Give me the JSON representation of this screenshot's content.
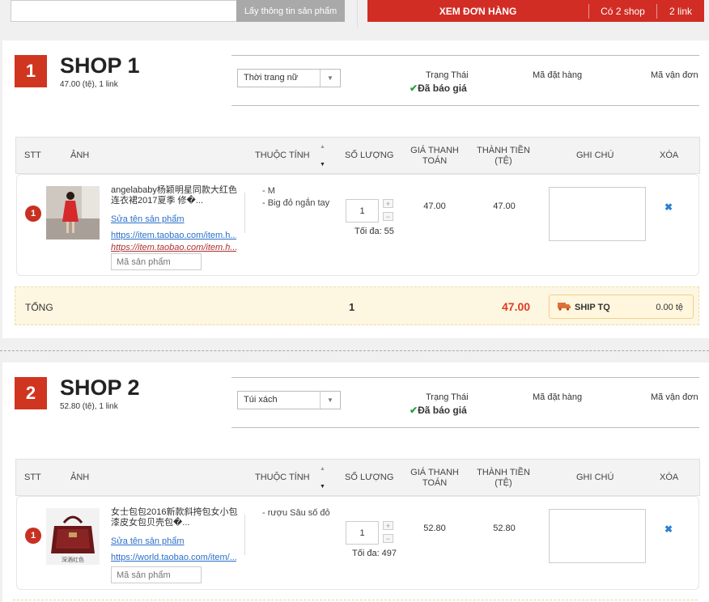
{
  "topbar": {
    "url_value": "",
    "fetch_label": "Lấy thông tin sản phẩm",
    "view_orders_label": "XEM ĐƠN HÀNG",
    "shop_count_label": "Có 2 shop",
    "link_count_label": "2 link"
  },
  "table_headers": {
    "stt": "STT",
    "image": "ẢNH",
    "attributes": "THUỘC TÍNH",
    "quantity": "SỐ LƯỢNG",
    "price": "GIÁ THANH TOÁN",
    "total": "THÀNH TIỀN (TỆ)",
    "note": "GHI CHÚ",
    "delete": "XÓA"
  },
  "status_labels": {
    "status": "Trạng Thái",
    "order_code": "Mã đặt hàng",
    "tracking_code": "Mã vận đơn"
  },
  "shops": [
    {
      "number": "1",
      "name": "SHOP 1",
      "summary": "47.00 (tệ), 1 link",
      "category": "Thời trang nữ",
      "status_value": "Đã báo giá",
      "item": {
        "index": "1",
        "name": "angelababy杨颖明星同款大红色连衣裙2017夏季 修�...",
        "edit_label": "Sửa tên sản phẩm",
        "link1": "https://item.taobao.com/item.h...",
        "link2": "https://item.taobao.com/item.h...",
        "code_placeholder": "Mã sản phẩm",
        "attr1": "- M",
        "attr2": "- Big đỏ ngắn tay",
        "quantity": "1",
        "max_qty": "Tối đa: 55",
        "price": "47.00",
        "total": "47.00",
        "image_colors": {
          "bg": "#cfc8c0",
          "dress": "#d62a2a"
        }
      },
      "summary_row": {
        "label": "TỔNG",
        "qty": "1",
        "amount": "47.00",
        "ship_label": "SHIP TQ",
        "ship_fee": "0.00 tệ"
      }
    },
    {
      "number": "2",
      "name": "SHOP 2",
      "summary": "52.80 (tệ), 1 link",
      "category": "Túi xách",
      "status_value": "Đã báo giá",
      "item": {
        "index": "1",
        "name": "女士包包2016新款斜挎包女小包漆皮女包贝壳包�...",
        "edit_label": "Sửa tên sản phẩm",
        "link1": "https://world.taobao.com/item/...",
        "code_placeholder": "Mã sản phẩm",
        "attr1": "- rượu Sâu số đỏ",
        "quantity": "1",
        "max_qty": "Tối đa: 497",
        "price": "52.80",
        "total": "52.80",
        "image_caption": "深酒红色",
        "image_colors": {
          "bg": "#f2f2f2",
          "bag": "#6a1818"
        }
      }
    }
  ],
  "colors": {
    "brand_red": "#d12d25",
    "badge_red": "#d03520",
    "total_red": "#e03c23",
    "status_green": "#2aa040",
    "link_blue": "#2a6fc9"
  }
}
